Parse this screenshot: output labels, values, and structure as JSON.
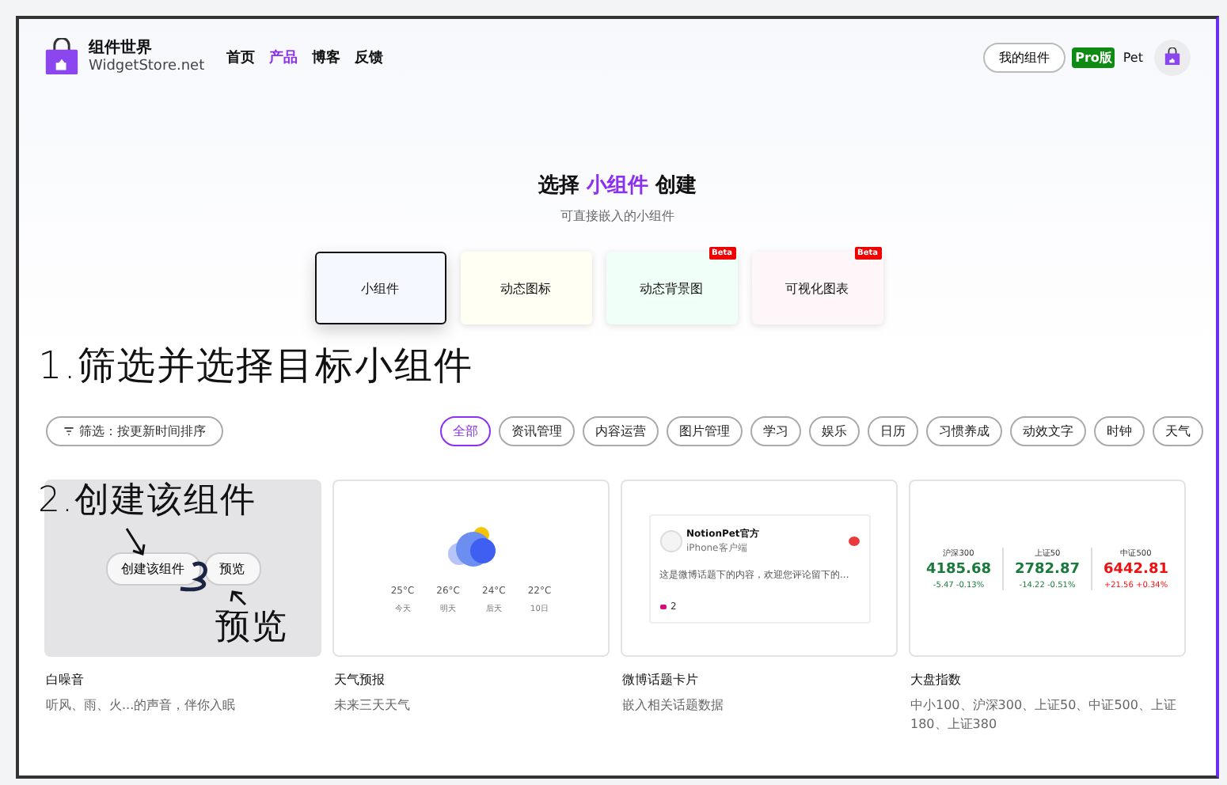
{
  "header": {
    "logo_title": "组件世界",
    "logo_subtitle": "WidgetStore.net",
    "nav": [
      {
        "label": "首页",
        "selected": false
      },
      {
        "label": "产品",
        "selected": true
      },
      {
        "label": "博客",
        "selected": false
      },
      {
        "label": "反馈",
        "selected": false
      }
    ],
    "my_widgets_button": "我的组件",
    "pro_badge": "Pro版",
    "user_name": "Pet"
  },
  "hero": {
    "title": "选择 **小组件** 创建",
    "subtitle": "可直接嵌入的小组件"
  },
  "categories": [
    {
      "label": "小组件",
      "selected": true,
      "color": "#f5f8ff"
    },
    {
      "label": "动态图标",
      "selected": false,
      "color": "#fffff3"
    },
    {
      "label": "动态背景图",
      "selected": false,
      "color": "#f0fff8",
      "badge": "Beta"
    },
    {
      "label": "可视化图表",
      "selected": false,
      "color": "#fff6fa",
      "badge": "Beta"
    }
  ],
  "filter_button": "筛选：按更新时间排序",
  "tags": [
    {
      "label": "全部",
      "selected": true
    },
    {
      "label": "资讯管理",
      "selected": false
    },
    {
      "label": "内容运营",
      "selected": false
    },
    {
      "label": "图片管理",
      "selected": false
    },
    {
      "label": "学习",
      "selected": false
    },
    {
      "label": "娱乐",
      "selected": false
    },
    {
      "label": "日历",
      "selected": false
    },
    {
      "label": "习惯养成",
      "selected": false
    },
    {
      "label": "动效文字",
      "selected": false
    },
    {
      "label": "时钟",
      "selected": false
    },
    {
      "label": "天气",
      "selected": false
    }
  ],
  "widgets": [
    {
      "kind": "hover",
      "title": "白噪音",
      "description": "听风、雨、火...的声音，伴你入眠",
      "create_button": "创建该组件",
      "preview_button": "预览"
    },
    {
      "kind": "weather",
      "title": "天气预报",
      "description": "未来三天天气",
      "days": [
        {
          "temp": "25°C",
          "day": "今天"
        },
        {
          "temp": "26°C",
          "day": "明天"
        },
        {
          "temp": "24°C",
          "day": "后天"
        },
        {
          "temp": "22°C",
          "day": "10日"
        }
      ]
    },
    {
      "kind": "weibo",
      "title": "微博话题卡片",
      "description": "嵌入相关话题数据",
      "account": "NotionPet官方",
      "source": "iPhone客户端",
      "post": "这是微博话题下的内容，欢迎您评论留下的...",
      "likes": "2"
    },
    {
      "kind": "stocks",
      "title": "大盘指数",
      "description": "中小100、沪深300、上证50、中证500、上证180、上证380",
      "indices": [
        {
          "name": "沪深300",
          "value": "4185.68",
          "change": "-5.47 -0.13%",
          "color": "#1a7a3c"
        },
        {
          "name": "上证50",
          "value": "2782.87",
          "change": "-14.22 -0.51%",
          "color": "#1a7a3c"
        },
        {
          "name": "中证500",
          "value": "6442.81",
          "change": "+21.56 +0.34%",
          "color": "#ee1111"
        }
      ]
    }
  ],
  "annotations": [
    {
      "text": "1.筛选并选择目标小组件"
    },
    {
      "text": "2.创建该组件"
    },
    {
      "text": "预览"
    }
  ]
}
